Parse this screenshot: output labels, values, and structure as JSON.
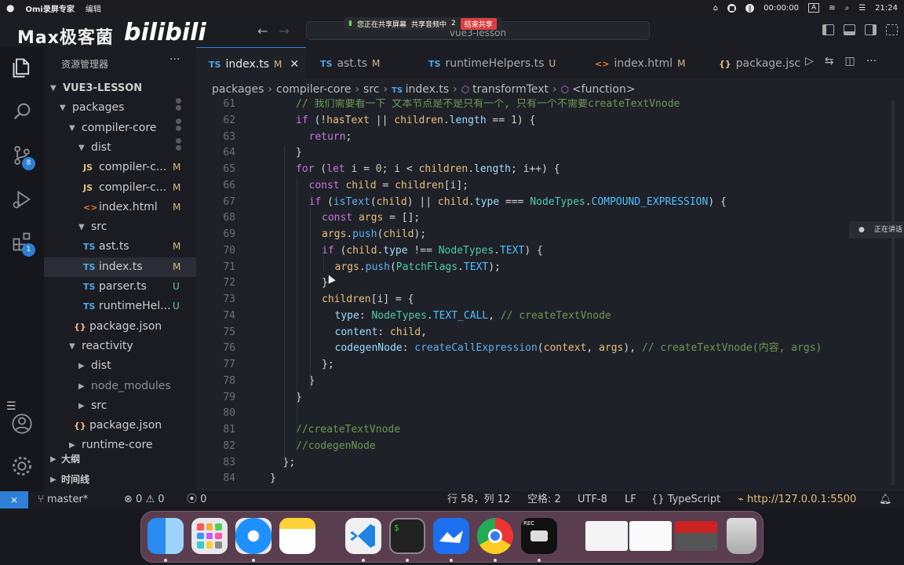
{
  "menubar": {
    "app_name": "Omi录屏专家",
    "menu_edit": "编辑",
    "timer": "00:00:00",
    "input_method": "A",
    "clock": "21:24"
  },
  "sharebar": {
    "sharing_screen": "您正在共享屏幕",
    "sharing_audio": "共享音频中",
    "participants": "2",
    "end_share": "结束共享"
  },
  "watermark": {
    "text": "Max极客菌",
    "logo": "bilibili"
  },
  "titlebar": {
    "search_text": "vue3-lesson"
  },
  "activity_bar": {
    "source_control_badge": "8",
    "extensions_badge": "1"
  },
  "sidebar": {
    "title": "资源管理器",
    "more": "···",
    "outline": "大纲",
    "timeline": "时间线",
    "tree": [
      {
        "name": "VUE3-LESSON",
        "depth": 0,
        "type": "root",
        "status": ""
      },
      {
        "name": "packages",
        "depth": 1,
        "type": "folder",
        "status": "dot"
      },
      {
        "name": "compiler-core",
        "depth": 2,
        "type": "folder",
        "status": "dot"
      },
      {
        "name": "dist",
        "depth": 3,
        "type": "folder",
        "status": "dot"
      },
      {
        "name": "compiler-c...",
        "depth": 4,
        "type": "js",
        "status": "M"
      },
      {
        "name": "compiler-c...",
        "depth": 4,
        "type": "js",
        "status": "M"
      },
      {
        "name": "index.html",
        "depth": 4,
        "type": "html",
        "status": "M"
      },
      {
        "name": "src",
        "depth": 3,
        "type": "folder",
        "status": ""
      },
      {
        "name": "ast.ts",
        "depth": 4,
        "type": "ts",
        "status": "M"
      },
      {
        "name": "index.ts",
        "depth": 4,
        "type": "ts",
        "status": "M",
        "active": true
      },
      {
        "name": "parser.ts",
        "depth": 4,
        "type": "ts",
        "status": "U"
      },
      {
        "name": "runtimeHel...",
        "depth": 4,
        "type": "ts",
        "status": "U"
      },
      {
        "name": "package.json",
        "depth": 3,
        "type": "json",
        "status": ""
      },
      {
        "name": "reactivity",
        "depth": 2,
        "type": "folder",
        "status": ""
      },
      {
        "name": "dist",
        "depth": 3,
        "type": "folder-closed",
        "status": ""
      },
      {
        "name": "node_modules",
        "depth": 3,
        "type": "folder-closed",
        "status": "",
        "dim": true
      },
      {
        "name": "src",
        "depth": 3,
        "type": "folder-closed",
        "status": ""
      },
      {
        "name": "package.json",
        "depth": 3,
        "type": "json",
        "status": ""
      },
      {
        "name": "runtime-core",
        "depth": 2,
        "type": "folder-closed",
        "status": ""
      }
    ]
  },
  "tabs": [
    {
      "icon": "TS",
      "label": "index.ts",
      "status": "M",
      "active": true
    },
    {
      "icon": "TS",
      "label": "ast.ts",
      "status": "M"
    },
    {
      "icon": "TS",
      "label": "runtimeHelpers.ts",
      "status": "U"
    },
    {
      "icon": "<>",
      "label": "index.html",
      "status": "M"
    },
    {
      "icon": "{}",
      "label": "package.jsc",
      "status": ""
    }
  ],
  "breadcrumb": [
    "packages",
    "compiler-core",
    "src",
    "index.ts",
    "transformText",
    "<function>"
  ],
  "editor": {
    "lines": [
      {
        "n": 61,
        "indent": 0,
        "tokens": [
          [
            "cm",
            "// 我们需要看一下 文本节点是不是只有一个, 只有一个不需要createTextVnode"
          ]
        ]
      },
      {
        "n": 62,
        "indent": 0,
        "tokens": [
          [
            "k",
            "if"
          ],
          [
            "op",
            " (!"
          ],
          [
            "v",
            "hasText"
          ],
          [
            "op",
            " || "
          ],
          [
            "v",
            "children"
          ],
          [
            "op",
            "."
          ],
          [
            "pr",
            "length"
          ],
          [
            "op",
            " == "
          ],
          [
            "num",
            "1"
          ],
          [
            "op",
            ") {"
          ]
        ]
      },
      {
        "n": 63,
        "indent": 1,
        "tokens": [
          [
            "k",
            "return"
          ],
          [
            "op",
            ";"
          ]
        ]
      },
      {
        "n": 64,
        "indent": 0,
        "tokens": [
          [
            "op",
            "}"
          ]
        ]
      },
      {
        "n": 65,
        "indent": 0,
        "tokens": [
          [
            "k",
            "for"
          ],
          [
            "op",
            " ("
          ],
          [
            "k",
            "let"
          ],
          [
            "op",
            " i = "
          ],
          [
            "num",
            "0"
          ],
          [
            "op",
            "; i < "
          ],
          [
            "v",
            "children"
          ],
          [
            "op",
            "."
          ],
          [
            "pr",
            "length"
          ],
          [
            "op",
            "; i++) {"
          ]
        ]
      },
      {
        "n": 66,
        "indent": 1,
        "tokens": [
          [
            "k",
            "const"
          ],
          [
            "op",
            " "
          ],
          [
            "v",
            "child"
          ],
          [
            "op",
            " = "
          ],
          [
            "v",
            "children"
          ],
          [
            "op",
            "[i];"
          ]
        ]
      },
      {
        "n": 67,
        "indent": 1,
        "tokens": [
          [
            "k",
            "if"
          ],
          [
            "op",
            " ("
          ],
          [
            "fn",
            "isText"
          ],
          [
            "op",
            "("
          ],
          [
            "v",
            "child"
          ],
          [
            "op",
            ") || "
          ],
          [
            "v",
            "child"
          ],
          [
            "op",
            "."
          ],
          [
            "pr",
            "type"
          ],
          [
            "op",
            " === "
          ],
          [
            "cls",
            "NodeTypes"
          ],
          [
            "op",
            "."
          ],
          [
            "cn",
            "COMPOUND_EXPRESSION"
          ],
          [
            "op",
            ") {"
          ]
        ]
      },
      {
        "n": 68,
        "indent": 2,
        "tokens": [
          [
            "k",
            "const"
          ],
          [
            "op",
            " "
          ],
          [
            "v",
            "args"
          ],
          [
            "op",
            " = [];"
          ]
        ]
      },
      {
        "n": 69,
        "indent": 2,
        "tokens": [
          [
            "v",
            "args"
          ],
          [
            "op",
            "."
          ],
          [
            "fn",
            "push"
          ],
          [
            "op",
            "("
          ],
          [
            "v",
            "child"
          ],
          [
            "op",
            ");"
          ]
        ]
      },
      {
        "n": 70,
        "indent": 2,
        "tokens": [
          [
            "k",
            "if"
          ],
          [
            "op",
            " ("
          ],
          [
            "v",
            "child"
          ],
          [
            "op",
            "."
          ],
          [
            "pr",
            "type"
          ],
          [
            "op",
            " !== "
          ],
          [
            "cls",
            "NodeTypes"
          ],
          [
            "op",
            "."
          ],
          [
            "cn",
            "TEXT"
          ],
          [
            "op",
            ") {"
          ]
        ]
      },
      {
        "n": 71,
        "indent": 3,
        "tokens": [
          [
            "v",
            "args"
          ],
          [
            "op",
            "."
          ],
          [
            "fn",
            "push"
          ],
          [
            "op",
            "("
          ],
          [
            "cls",
            "PatchFlags"
          ],
          [
            "op",
            "."
          ],
          [
            "cn",
            "TEXT"
          ],
          [
            "op",
            ");"
          ]
        ]
      },
      {
        "n": 72,
        "indent": 2,
        "tokens": [
          [
            "op",
            "}"
          ]
        ]
      },
      {
        "n": 73,
        "indent": 2,
        "tokens": [
          [
            "v",
            "children"
          ],
          [
            "op",
            "[i] = {"
          ]
        ]
      },
      {
        "n": 74,
        "indent": 3,
        "tokens": [
          [
            "pr",
            "type"
          ],
          [
            "op",
            ": "
          ],
          [
            "cls",
            "NodeTypes"
          ],
          [
            "op",
            "."
          ],
          [
            "cn",
            "TEXT_CALL"
          ],
          [
            "op",
            ", "
          ],
          [
            "cm",
            "// createTextVnode"
          ]
        ]
      },
      {
        "n": 75,
        "indent": 3,
        "tokens": [
          [
            "pr",
            "content"
          ],
          [
            "op",
            ": "
          ],
          [
            "v",
            "child"
          ],
          [
            "op",
            ","
          ]
        ]
      },
      {
        "n": 76,
        "indent": 3,
        "tokens": [
          [
            "pr",
            "codegenNode"
          ],
          [
            "op",
            ": "
          ],
          [
            "fn",
            "createCallExpression"
          ],
          [
            "op",
            "("
          ],
          [
            "v",
            "context"
          ],
          [
            "op",
            ", "
          ],
          [
            "v",
            "args"
          ],
          [
            "op",
            "), "
          ],
          [
            "cm",
            "// createTextVnode(内容, args)"
          ]
        ]
      },
      {
        "n": 77,
        "indent": 2,
        "tokens": [
          [
            "op",
            "};"
          ]
        ]
      },
      {
        "n": 78,
        "indent": 1,
        "tokens": [
          [
            "op",
            "}"
          ]
        ]
      },
      {
        "n": 79,
        "indent": 0,
        "tokens": [
          [
            "op",
            "}"
          ]
        ]
      },
      {
        "n": 80,
        "indent": 0,
        "tokens": []
      },
      {
        "n": 81,
        "indent": 0,
        "tokens": [
          [
            "cm",
            "//createTextVnode"
          ]
        ]
      },
      {
        "n": 82,
        "indent": 0,
        "tokens": [
          [
            "cm",
            "//codegenNode"
          ]
        ]
      },
      {
        "n": 83,
        "indent": -1,
        "tokens": [
          [
            "op",
            "};"
          ]
        ]
      },
      {
        "n": 84,
        "indent": -2,
        "tokens": [
          [
            "op",
            "}"
          ]
        ]
      }
    ]
  },
  "talking_indicator": "正在讲话",
  "statusbar": {
    "branch": "master*",
    "errors": "0",
    "warnings": "0",
    "ports": "0",
    "position": "行 58，列 12",
    "spaces": "空格: 2",
    "encoding": "UTF-8",
    "eol": "LF",
    "language": "TypeScript",
    "live_server": "http://127.0.0.1:5500"
  },
  "colors": {
    "accent": "#2f7fd6",
    "modified": "#d7ba7d",
    "untracked": "#73c991"
  },
  "dock": {
    "apps": [
      "finder-icon",
      "launchpad-icon",
      "safari-icon",
      "notes-icon",
      "vscode-icon",
      "terminal-icon",
      "lark-icon",
      "chrome-icon",
      "camera-rec-icon",
      "window-thumb",
      "window-thumb",
      "window-thumb",
      "trash-icon"
    ],
    "terminal_text": "$",
    "rec_text": "REC"
  }
}
